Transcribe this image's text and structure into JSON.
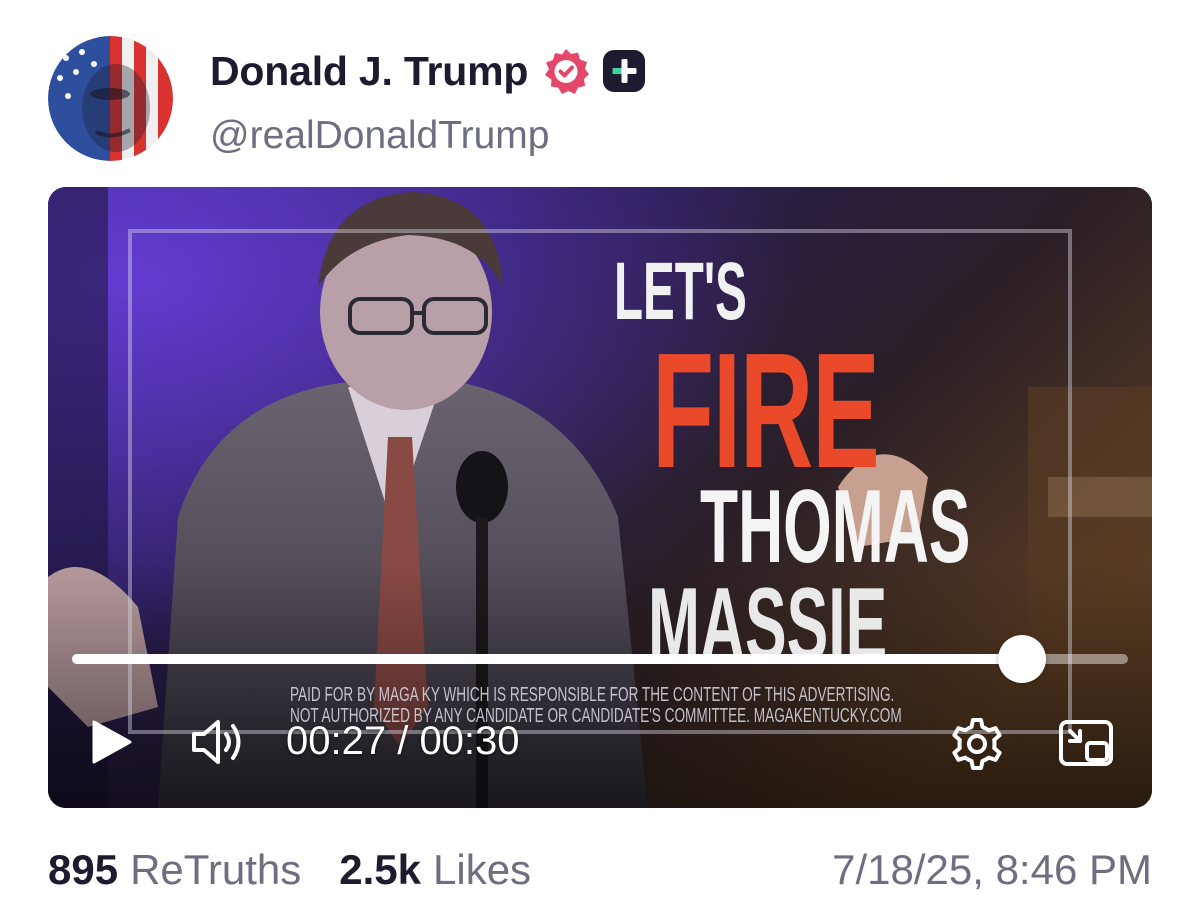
{
  "author": {
    "display_name": "Donald J. Trump",
    "handle": "@realDonaldTrump",
    "avatar_icon": "flag-portrait-avatar",
    "verified_badge_color": "#e5476b",
    "plus_badge_color": "#1c1b30"
  },
  "video": {
    "overlay": {
      "line1": "LET'S",
      "line2": "FIRE",
      "line3": "THOMAS",
      "line4": "MASSIE",
      "disclaimer_line1": "PAID FOR BY MAGA KY WHICH IS RESPONSIBLE FOR THE CONTENT OF THIS ADVERTISING.",
      "disclaimer_line2": "NOT AUTHORIZED BY ANY CANDIDATE OR CANDIDATE'S COMMITTEE. MAGAKENTUCKY.COM"
    },
    "player": {
      "current_time": "00:27",
      "duration": "00:30",
      "time_display": "00:27 / 00:30",
      "progress": 0.9,
      "play_icon": "play-icon",
      "volume_icon": "volume-icon",
      "settings_icon": "gear-icon",
      "pip_icon": "picture-in-picture-icon"
    }
  },
  "stats": {
    "retruths_count": "895",
    "retruths_label": "ReTruths",
    "likes_count": "2.5k",
    "likes_label": "Likes"
  },
  "timestamp": "7/18/25, 8:46 PM",
  "colors": {
    "name_text": "#1c1b30",
    "secondary_text": "#6d6e82",
    "fire_text": "#ea4a2a"
  }
}
